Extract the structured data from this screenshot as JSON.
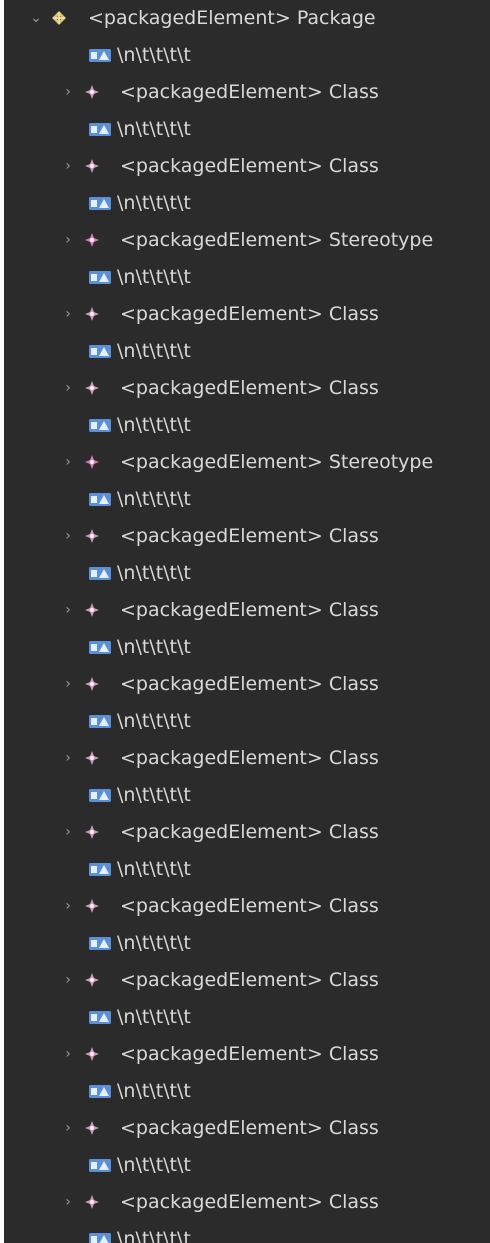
{
  "tree": {
    "root": {
      "label": "<packagedElement> Package",
      "icon": "package-icon",
      "expanded": true
    },
    "children": [
      {
        "kind": "text",
        "label": "\\n\\t\\t\\t\\t"
      },
      {
        "kind": "element",
        "label": "<packagedElement> Class",
        "icon": "class-icon"
      },
      {
        "kind": "text",
        "label": "\\n\\t\\t\\t\\t"
      },
      {
        "kind": "element",
        "label": "<packagedElement> Class",
        "icon": "class-icon"
      },
      {
        "kind": "text",
        "label": "\\n\\t\\t\\t\\t"
      },
      {
        "kind": "element",
        "label": "<packagedElement> Stereotype",
        "icon": "stereotype-icon"
      },
      {
        "kind": "text",
        "label": "\\n\\t\\t\\t\\t"
      },
      {
        "kind": "element",
        "label": "<packagedElement> Class",
        "icon": "class-icon"
      },
      {
        "kind": "text",
        "label": "\\n\\t\\t\\t\\t"
      },
      {
        "kind": "element",
        "label": "<packagedElement> Class",
        "icon": "class-icon"
      },
      {
        "kind": "text",
        "label": "\\n\\t\\t\\t\\t"
      },
      {
        "kind": "element",
        "label": "<packagedElement> Stereotype",
        "icon": "stereotype-icon"
      },
      {
        "kind": "text",
        "label": "\\n\\t\\t\\t\\t"
      },
      {
        "kind": "element",
        "label": "<packagedElement> Class",
        "icon": "class-icon"
      },
      {
        "kind": "text",
        "label": "\\n\\t\\t\\t\\t"
      },
      {
        "kind": "element",
        "label": "<packagedElement> Class",
        "icon": "class-icon"
      },
      {
        "kind": "text",
        "label": "\\n\\t\\t\\t\\t"
      },
      {
        "kind": "element",
        "label": "<packagedElement> Class",
        "icon": "class-icon"
      },
      {
        "kind": "text",
        "label": "\\n\\t\\t\\t\\t"
      },
      {
        "kind": "element",
        "label": "<packagedElement> Class",
        "icon": "class-icon"
      },
      {
        "kind": "text",
        "label": "\\n\\t\\t\\t\\t"
      },
      {
        "kind": "element",
        "label": "<packagedElement> Class",
        "icon": "class-icon"
      },
      {
        "kind": "text",
        "label": "\\n\\t\\t\\t\\t"
      },
      {
        "kind": "element",
        "label": "<packagedElement> Class",
        "icon": "class-icon"
      },
      {
        "kind": "text",
        "label": "\\n\\t\\t\\t\\t"
      },
      {
        "kind": "element",
        "label": "<packagedElement> Class",
        "icon": "class-icon"
      },
      {
        "kind": "text",
        "label": "\\n\\t\\t\\t\\t"
      },
      {
        "kind": "element",
        "label": "<packagedElement> Class",
        "icon": "class-icon"
      },
      {
        "kind": "text",
        "label": "\\n\\t\\t\\t\\t"
      },
      {
        "kind": "element",
        "label": "<packagedElement> Class",
        "icon": "class-icon"
      },
      {
        "kind": "text",
        "label": "\\n\\t\\t\\t\\t"
      },
      {
        "kind": "element",
        "label": "<packagedElement> Class",
        "icon": "class-icon"
      },
      {
        "kind": "text",
        "label": "\\n\\t\\t\\t\\t"
      }
    ]
  },
  "colors": {
    "background": "#2b2b2b",
    "text": "#d9d9d9",
    "chevron": "#9a9a9a",
    "package_icon": "#d9c27a",
    "class_icon": "#c89ab8",
    "stereotype_icon": "#d97ab8",
    "text_node_icon": "#5b8fd6"
  }
}
